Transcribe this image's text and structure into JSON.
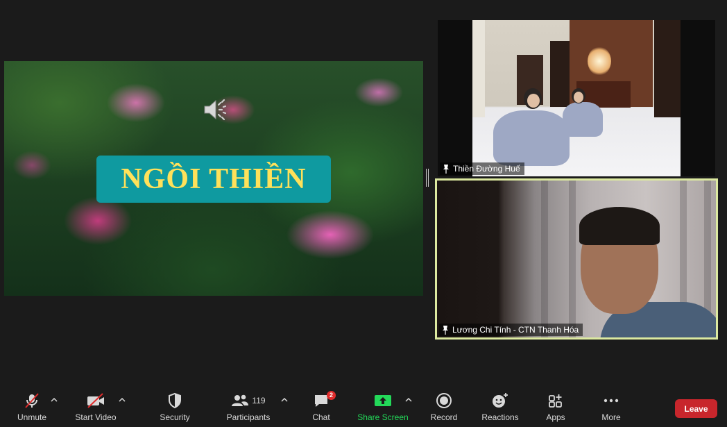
{
  "shared_content": {
    "title": "NGỒI THIỀN",
    "speaker_icon": "speaker-volume-icon"
  },
  "videos": [
    {
      "name": "Thiền Đường Huế",
      "pinned": true
    },
    {
      "name": "Lương Chi Tính - CTN Thanh Hóa",
      "pinned": true,
      "active_speaker": true,
      "highlight_color": "#dce9a0"
    }
  ],
  "toolbar": {
    "unmute": "Unmute",
    "start_video": "Start Video",
    "security": "Security",
    "participants": "Participants",
    "participants_count": "119",
    "chat": "Chat",
    "chat_badge": "2",
    "share_screen": "Share Screen",
    "record": "Record",
    "reactions": "Reactions",
    "apps": "Apps",
    "more": "More",
    "leave": "Leave"
  },
  "colors": {
    "background": "#1b1b1b",
    "share_green": "#23d959",
    "leave_red": "#c8262c",
    "title_teal": "#0f9aa0",
    "title_yellow": "#ffe15a"
  }
}
